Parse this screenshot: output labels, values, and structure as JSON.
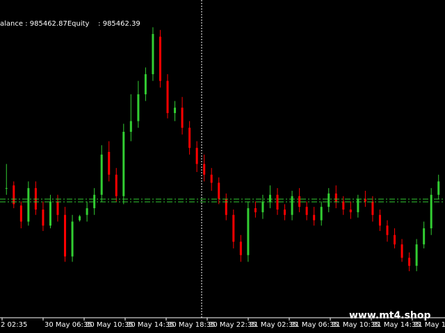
{
  "account": {
    "balance_text": "alance : 985462.87Equity    : 985462.39"
  },
  "watermark": "www.mt4.shop",
  "colors": {
    "background": "#000000",
    "bull": "#32cd32",
    "bear": "#ff0000",
    "level_line": "#32cd32",
    "crosshair": "#ffffff",
    "text": "#ffffff"
  },
  "chart_data": {
    "type": "candlestick",
    "title": "",
    "x_tick_labels": [
      "2 02:35",
      "30 May 06:35",
      "30 May 10:35",
      "30 May 14:35",
      "30 May 18:35",
      "30 May 22:35",
      "31 May 02:35",
      "31 May 06:35",
      "31 May 10:35",
      "31 May 14:35",
      "31 May 18:35",
      "31 M"
    ],
    "series": [
      {
        "values": [
          [
            250,
            268,
            245,
            250
          ],
          [
            252,
            255,
            235,
            238
          ],
          [
            237,
            240,
            220,
            225
          ],
          [
            225,
            255,
            222,
            250
          ],
          [
            250,
            255,
            230,
            234
          ],
          [
            234,
            240,
            218,
            222
          ],
          [
            222,
            245,
            220,
            240
          ],
          [
            240,
            245,
            225,
            230
          ],
          [
            230,
            236,
            195,
            199
          ],
          [
            199,
            230,
            195,
            225
          ],
          [
            226,
            230,
            225,
            229
          ],
          [
            230,
            240,
            225,
            235
          ],
          [
            235,
            250,
            230,
            245
          ],
          [
            245,
            282,
            240,
            275
          ],
          [
            277,
            285,
            255,
            260
          ],
          [
            260,
            265,
            240,
            244
          ],
          [
            244,
            298,
            238,
            292
          ],
          [
            292,
            320,
            285,
            300
          ],
          [
            300,
            330,
            295,
            320
          ],
          [
            320,
            340,
            315,
            335
          ],
          [
            335,
            370,
            330,
            365
          ],
          [
            363,
            368,
            325,
            330
          ],
          [
            330,
            335,
            302,
            306
          ],
          [
            306,
            315,
            300,
            310
          ],
          [
            310,
            318,
            290,
            295
          ],
          [
            295,
            300,
            275,
            280
          ],
          [
            280,
            285,
            262,
            268
          ],
          [
            268,
            275,
            255,
            260
          ],
          [
            260,
            265,
            248,
            254
          ],
          [
            254,
            258,
            238,
            242
          ],
          [
            242,
            246,
            226,
            230
          ],
          [
            230,
            234,
            205,
            210
          ],
          [
            210,
            215,
            195,
            200
          ],
          [
            200,
            240,
            195,
            235
          ],
          [
            235,
            240,
            228,
            232
          ],
          [
            232,
            245,
            227,
            240
          ],
          [
            240,
            252,
            235,
            245
          ],
          [
            245,
            250,
            230,
            234
          ],
          [
            234,
            238,
            226,
            230
          ],
          [
            230,
            248,
            226,
            244
          ],
          [
            244,
            250,
            232,
            236
          ],
          [
            236,
            240,
            226,
            230
          ],
          [
            230,
            236,
            222,
            226
          ],
          [
            226,
            240,
            222,
            236
          ],
          [
            236,
            250,
            232,
            246
          ],
          [
            246,
            252,
            235,
            240
          ],
          [
            240,
            244,
            230,
            234
          ],
          [
            234,
            240,
            227,
            232
          ],
          [
            232,
            245,
            228,
            242
          ],
          [
            242,
            248,
            236,
            240
          ],
          [
            240,
            244,
            225,
            230
          ],
          [
            230,
            234,
            218,
            222
          ],
          [
            222,
            226,
            210,
            215
          ],
          [
            215,
            220,
            205,
            208
          ],
          [
            208,
            212,
            195,
            198
          ],
          [
            198,
            202,
            188,
            192
          ],
          [
            192,
            212,
            188,
            208
          ],
          [
            208,
            225,
            205,
            220
          ],
          [
            220,
            250,
            215,
            245
          ],
          [
            245,
            260,
            242,
            255
          ]
        ]
      }
    ]
  }
}
